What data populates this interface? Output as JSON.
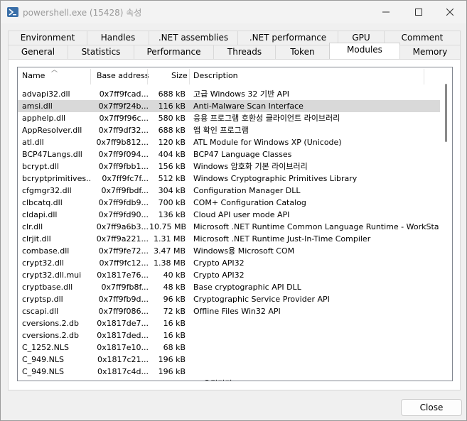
{
  "window": {
    "title": "powershell.exe (15428) 속성"
  },
  "tabs_row1": [
    "Environment",
    "Handles",
    ".NET assemblies",
    ".NET performance",
    "GPU",
    "Comment"
  ],
  "tabs_row2": [
    "General",
    "Statistics",
    "Performance",
    "Threads",
    "Token",
    "Modules",
    "Memory"
  ],
  "active_tab": "Modules",
  "columns": {
    "name": "Name",
    "base": "Base address",
    "size": "Size",
    "desc": "Description"
  },
  "modules": [
    {
      "name": "advapi32.dll",
      "base": "0x7ff9fcad...",
      "size": "688 kB",
      "desc": "고급 Windows 32 기반 API"
    },
    {
      "name": "amsi.dll",
      "base": "0x7ff9f24b...",
      "size": "116 kB",
      "desc": "Anti-Malware Scan Interface",
      "selected": true
    },
    {
      "name": "apphelp.dll",
      "base": "0x7ff9f96c...",
      "size": "580 kB",
      "desc": "응용 프로그램 호환성 클라이언트 라이브러리"
    },
    {
      "name": "AppResolver.dll",
      "base": "0x7ff9df32...",
      "size": "688 kB",
      "desc": "앱 확인 프로그램"
    },
    {
      "name": "atl.dll",
      "base": "0x7ff9b812...",
      "size": "120 kB",
      "desc": "ATL Module for Windows XP (Unicode)"
    },
    {
      "name": "BCP47Langs.dll",
      "base": "0x7ff9f094...",
      "size": "404 kB",
      "desc": "BCP47 Language Classes"
    },
    {
      "name": "bcrypt.dll",
      "base": "0x7ff9fbb1...",
      "size": "156 kB",
      "desc": "Windows 암호화 기본 라이브러리"
    },
    {
      "name": "bcryptprimitives...",
      "base": "0x7ff9fc7f...",
      "size": "512 kB",
      "desc": "Windows Cryptographic Primitives Library"
    },
    {
      "name": "cfgmgr32.dll",
      "base": "0x7ff9fbdf...",
      "size": "304 kB",
      "desc": "Configuration Manager DLL"
    },
    {
      "name": "clbcatq.dll",
      "base": "0x7ff9fdb9...",
      "size": "700 kB",
      "desc": "COM+ Configuration Catalog"
    },
    {
      "name": "cldapi.dll",
      "base": "0x7ff9fd90...",
      "size": "136 kB",
      "desc": "Cloud API user mode API"
    },
    {
      "name": "clr.dll",
      "base": "0x7ff9a6b3...",
      "size": "10.75 MB",
      "desc": "Microsoft .NET Runtime Common Language Runtime - WorkStation"
    },
    {
      "name": "clrjit.dll",
      "base": "0x7ff9a221...",
      "size": "1.31 MB",
      "desc": "Microsoft .NET Runtime Just-In-Time Compiler"
    },
    {
      "name": "combase.dll",
      "base": "0x7ff9fe72...",
      "size": "3.47 MB",
      "desc": "Windows용 Microsoft COM"
    },
    {
      "name": "crypt32.dll",
      "base": "0x7ff9fc12...",
      "size": "1.38 MB",
      "desc": "Crypto API32"
    },
    {
      "name": "crypt32.dll.mui",
      "base": "0x1817e76...",
      "size": "40 kB",
      "desc": "Crypto API32"
    },
    {
      "name": "cryptbase.dll",
      "base": "0x7ff9fb8f...",
      "size": "48 kB",
      "desc": "Base cryptographic API DLL"
    },
    {
      "name": "cryptsp.dll",
      "base": "0x7ff9fb9d...",
      "size": "96 kB",
      "desc": "Cryptographic Service Provider API"
    },
    {
      "name": "cscapi.dll",
      "base": "0x7ff9f086...",
      "size": "72 kB",
      "desc": "Offline Files Win32 API"
    },
    {
      "name": "cversions.2.db",
      "base": "0x1817de7...",
      "size": "16 kB",
      "desc": ""
    },
    {
      "name": "cversions.2.db",
      "base": "0x1817ded...",
      "size": "16 kB",
      "desc": ""
    },
    {
      "name": "C_1252.NLS",
      "base": "0x1817e10...",
      "size": "68 kB",
      "desc": ""
    },
    {
      "name": "C_949.NLS",
      "base": "0x1817c21...",
      "size": "196 kB",
      "desc": ""
    },
    {
      "name": "C_949.NLS",
      "base": "0x1817c4d...",
      "size": "196 kB",
      "desc": ""
    },
    {
      "name": "",
      "base": "",
      "size": "",
      "desc": "... 유틸리티"
    }
  ],
  "buttons": {
    "close": "Close"
  }
}
